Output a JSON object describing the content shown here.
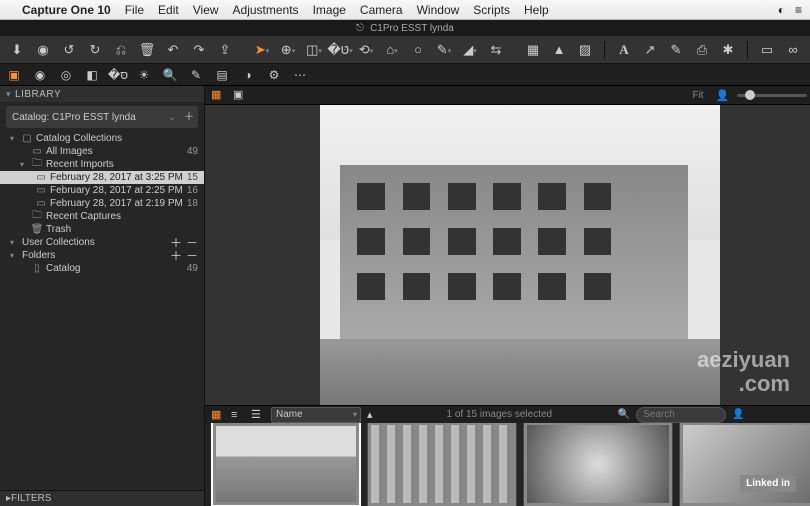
{
  "menubar": {
    "app_name": "Capture One 10",
    "items": [
      "File",
      "Edit",
      "View",
      "Adjustments",
      "Image",
      "Camera",
      "Window",
      "Scripts",
      "Help"
    ]
  },
  "window_title": "C1Pro ESST lynda",
  "sidebar": {
    "library_label": "LIBRARY",
    "catalog_label": "Catalog: C1Pro ESST lynda",
    "catalog_collections_label": "Catalog Collections",
    "all_images": {
      "label": "All Images",
      "count": "49"
    },
    "recent_imports_label": "Recent Imports",
    "imports": [
      {
        "label": "February 28, 2017 at 3:25 PM",
        "count": "15",
        "selected": true
      },
      {
        "label": "February 28, 2017 at 2:25 PM",
        "count": "16",
        "selected": false
      },
      {
        "label": "February 28, 2017 at 2:19 PM",
        "count": "18",
        "selected": false
      }
    ],
    "recent_captures_label": "Recent Captures",
    "trash_label": "Trash",
    "user_collections_label": "User Collections",
    "folders_label": "Folders",
    "catalog_folder": {
      "label": "Catalog",
      "count": "49"
    },
    "filters_label": "FILTERS"
  },
  "viewer_bar": {
    "fit_label": "Fit"
  },
  "browser_bar": {
    "sort_label": "Name",
    "status": "1 of 15 images selected",
    "search_placeholder": "Search"
  },
  "watermark": {
    "line1": "aeziyuan",
    "line2": ".com"
  },
  "linkedin": "Linked in"
}
